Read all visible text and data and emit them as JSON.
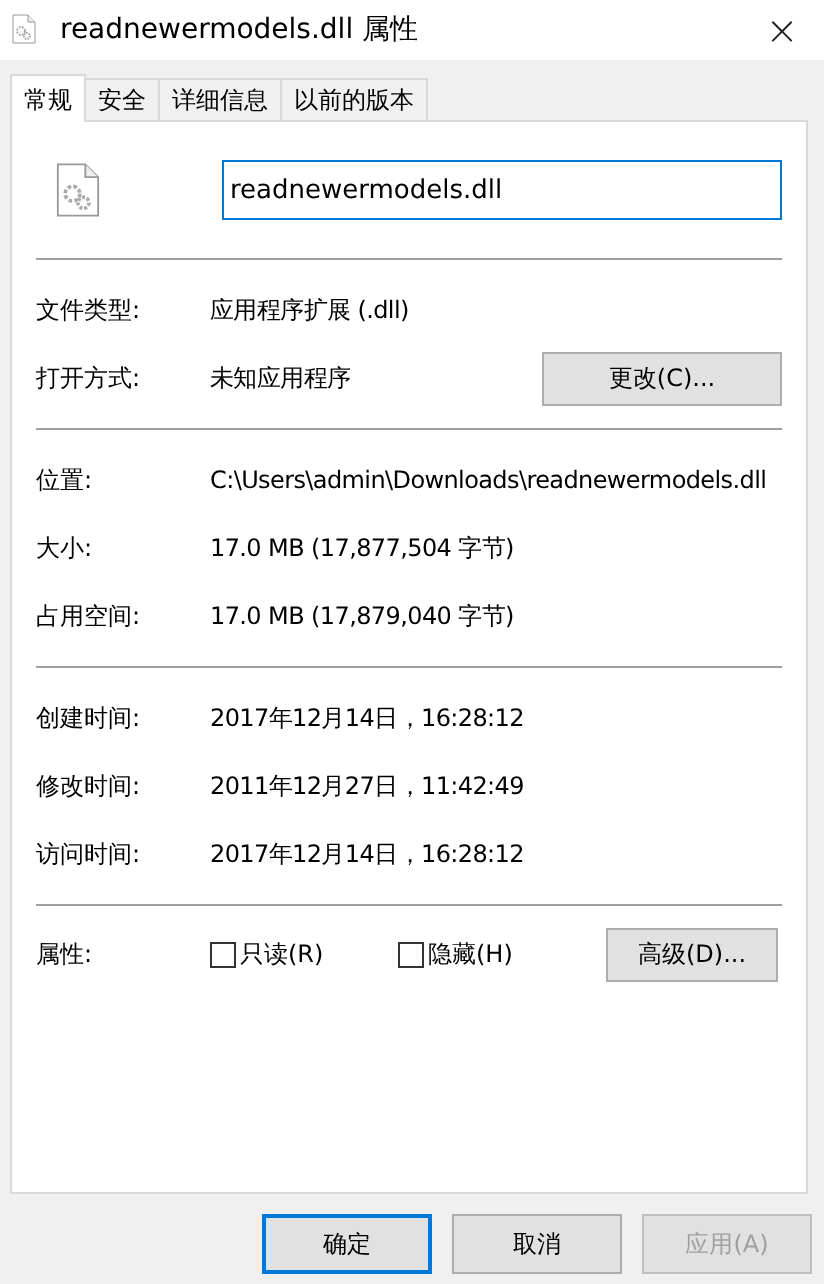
{
  "window": {
    "title": "readnewermodels.dll 属性",
    "close": "×"
  },
  "tabs": [
    {
      "label": "常规",
      "selected": true
    },
    {
      "label": "安全",
      "selected": false
    },
    {
      "label": "详细信息",
      "selected": false
    },
    {
      "label": "以前的版本",
      "selected": false
    }
  ],
  "file_name": "readnewermodels.dll",
  "sections": [
    {
      "rows": [
        {
          "label": "文件类型:",
          "value": "应用程序扩展 (.dll)"
        },
        {
          "label": "打开方式:",
          "value": "未知应用程序",
          "button": "更改(C)..."
        }
      ]
    },
    {
      "rows": [
        {
          "label": "位置:",
          "value": "C:\\Users\\admin\\Downloads\\readnewermodels.dll"
        },
        {
          "label": "大小:",
          "value": "17.0 MB (17,877,504 字节)"
        },
        {
          "label": "占用空间:",
          "value": "17.0 MB (17,879,040 字节)"
        }
      ]
    },
    {
      "rows": [
        {
          "label": "创建时间:",
          "value": "2017年12月14日，16:28:12"
        },
        {
          "label": "修改时间:",
          "value": "2011年12月27日，11:42:49"
        },
        {
          "label": "访问时间:",
          "value": "2017年12月14日，16:28:12"
        }
      ]
    }
  ],
  "attributes": {
    "label": "属性:",
    "checkboxes": [
      {
        "label": "只读(R)",
        "checked": false
      },
      {
        "label": "隐藏(H)",
        "checked": false
      }
    ],
    "button": "高级(D)..."
  },
  "buttons": [
    {
      "label": "确定",
      "default": true,
      "disabled": false
    },
    {
      "label": "取消",
      "default": false,
      "disabled": false
    },
    {
      "label": "应用(A)",
      "default": false,
      "disabled": true
    }
  ]
}
